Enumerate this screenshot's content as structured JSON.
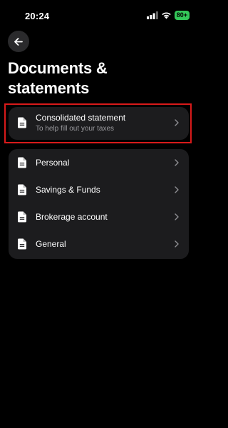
{
  "status_bar": {
    "time": "20:24",
    "battery": "80+",
    "battery_color": "#34c759",
    "icons": [
      "signal-icon",
      "wifi-icon",
      "battery-icon"
    ]
  },
  "header": {
    "back_icon": "arrow-left-icon",
    "title": "Documents & statements"
  },
  "highlight_color": "#d81a1a",
  "featured": {
    "label": "Consolidated statement",
    "subtitle": "To help fill out your taxes"
  },
  "list": {
    "items": [
      {
        "label": "Personal"
      },
      {
        "label": "Savings & Funds"
      },
      {
        "label": "Brokerage account"
      },
      {
        "label": "General"
      }
    ]
  }
}
